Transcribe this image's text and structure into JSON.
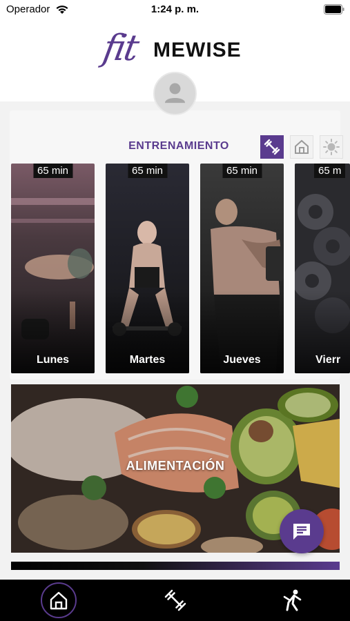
{
  "status_bar": {
    "carrier": "Operador",
    "time": "1:24 p. m."
  },
  "logo": {
    "script_part": "fit",
    "word_part": "MEWISE"
  },
  "training": {
    "title": "ENTRENAMIENTO",
    "filters": [
      {
        "icon": "dumbbell-icon",
        "active": true
      },
      {
        "icon": "home-icon",
        "active": false
      },
      {
        "icon": "sun-icon",
        "active": false
      }
    ],
    "days": [
      {
        "duration": "65 min",
        "label": "Lunes"
      },
      {
        "duration": "65 min",
        "label": "Martes"
      },
      {
        "duration": "65 min",
        "label": "Jueves"
      },
      {
        "duration": "65 m",
        "label": "Vierr"
      }
    ]
  },
  "nutrition": {
    "label": "ALIMENTACIÓN"
  },
  "chat": {
    "icon": "chat-bubble-icon"
  },
  "nav": {
    "items": [
      {
        "icon": "home-icon",
        "active": true
      },
      {
        "icon": "dumbbell-icon",
        "active": false
      },
      {
        "icon": "stretching-icon",
        "active": false
      }
    ]
  },
  "colors": {
    "accent": "#5a3b8e",
    "nav_background": "#000000",
    "content_background": "#f2f2f2"
  }
}
